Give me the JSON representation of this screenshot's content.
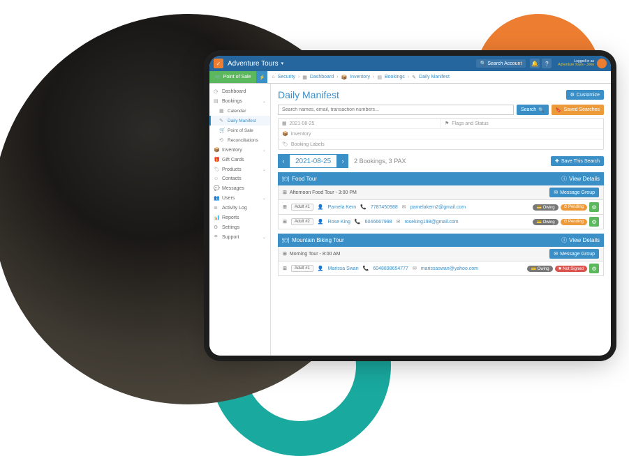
{
  "topbar": {
    "brand": "Adventure Tours",
    "search_account": "Search Account",
    "login_line1": "Logged in as",
    "login_line2": "Adventure Tours - John"
  },
  "toolbar": {
    "pos": "Point of Sale"
  },
  "breadcrumbs": [
    "Security",
    "Dashboard",
    "Inventory",
    "Bookings",
    "Daily Manifest"
  ],
  "sidebar": {
    "dashboard": "Dashboard",
    "bookings": "Bookings",
    "calendar": "Calendar",
    "daily_manifest": "Daily Manifest",
    "point_of_sale": "Point of Sale",
    "reconciliations": "Reconciliations",
    "inventory": "Inventory",
    "gift_cards": "Gift Cards",
    "products": "Products",
    "contacts": "Contacts",
    "messages": "Messages",
    "users": "Users",
    "activity_log": "Activity Log",
    "reports": "Reports",
    "settings": "Settings",
    "support": "Support"
  },
  "page": {
    "title": "Daily Manifest",
    "customize": "Customize",
    "search_placeholder": "Search names, email, transaction numbers...",
    "search_btn": "Search",
    "saved_searches": "Saved Searches",
    "filter_date": "2021-08-25",
    "filter_flags": "Flags and Status",
    "filter_inventory": "Inventory",
    "filter_labels": "Booking Labels",
    "nav_date": "2021-08-25",
    "summary": "2 Bookings, 3 PAX",
    "save_search": "Save This Search",
    "view_details": "View Details",
    "message_group": "Message Group"
  },
  "badges": {
    "owing": "Owing",
    "pending": "Pending",
    "not_signed": "Not Signed"
  },
  "tours": [
    {
      "name": "Food Tour",
      "session": "Afternoon Food Tour - 3:00 PM",
      "rows": [
        {
          "slot": "Adult #1",
          "name": "Pamela Kern",
          "phone": "7787450988",
          "email": "pamelakern2@gmail.com",
          "status": [
            "owing",
            "pending"
          ]
        },
        {
          "slot": "Adult #2",
          "name": "Rose King",
          "phone": "6046667998",
          "email": "roseking198@gmail.com",
          "status": [
            "owing",
            "pending"
          ]
        }
      ]
    },
    {
      "name": "Mountain Biking Tour",
      "session": "Morning Tour - 8:00 AM",
      "rows": [
        {
          "slot": "Adult #1",
          "name": "Marissa Swan",
          "phone": "6048898654777",
          "email": "marissaswan@yahoo.com",
          "status": [
            "owing",
            "notsigned"
          ]
        }
      ]
    }
  ]
}
